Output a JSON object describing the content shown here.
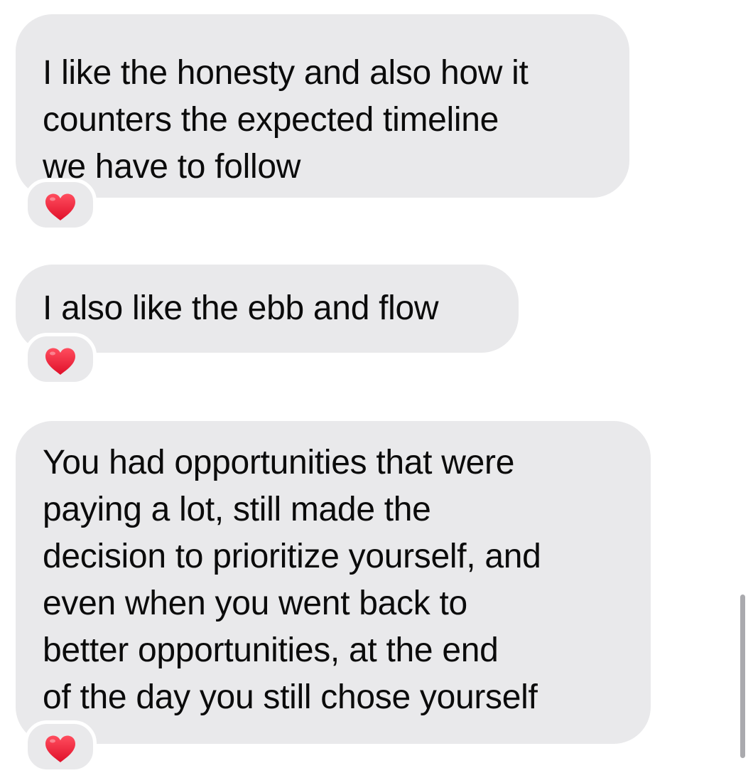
{
  "conversation": {
    "messages": [
      {
        "lines": [
          "I like the honesty and also how it",
          "counters the expected timeline",
          "we have to follow"
        ],
        "reaction": "red-heart"
      },
      {
        "lines": [
          "I also like the ebb and flow"
        ],
        "reaction": "red-heart"
      },
      {
        "lines": [
          "You had opportunities that were",
          "paying a lot, still made the",
          "decision to prioritize yourself, and",
          "even when you went back to",
          "better opportunities, at the end",
          "of the day you still chose yourself"
        ],
        "reaction": "red-heart"
      }
    ]
  },
  "colors": {
    "bubble_background": "#e9e9eb",
    "text": "#0b0b0b",
    "heart": "#ef1f3b"
  }
}
